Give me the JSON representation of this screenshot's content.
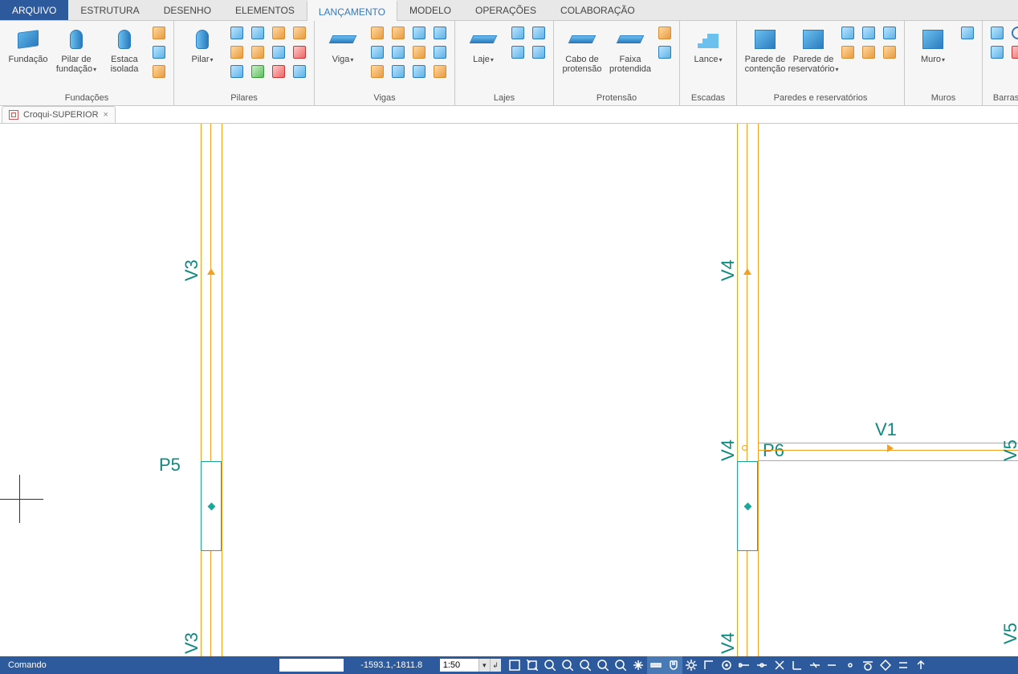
{
  "tabs": {
    "file": "ARQUIVO",
    "items": [
      "ESTRUTURA",
      "DESENHO",
      "ELEMENTOS",
      "LANÇAMENTO",
      "MODELO",
      "OPERAÇÕES",
      "COLABORAÇÃO"
    ],
    "active_index": 3
  },
  "ribbon": {
    "groups": [
      {
        "title": "Fundações",
        "big": [
          {
            "name": "fundacao",
            "label": "Fundação"
          },
          {
            "name": "pilar-fundacao",
            "label": "Pilar de\nfundação",
            "drop": true
          },
          {
            "name": "estaca",
            "label": "Estaca\nisolada"
          }
        ],
        "small_cols": [
          [
            "mini o",
            "mini b",
            "mini o"
          ]
        ]
      },
      {
        "title": "Pilares",
        "big": [
          {
            "name": "pilar",
            "label": "Pilar",
            "drop": true
          }
        ],
        "small_cols": [
          [
            "mini b",
            "mini o",
            "mini b"
          ],
          [
            "mini b",
            "mini o",
            "mini g"
          ],
          [
            "mini o",
            "mini b",
            "mini r"
          ],
          [
            "mini o",
            "mini r",
            "mini b"
          ]
        ]
      },
      {
        "title": "Vigas",
        "big": [
          {
            "name": "viga",
            "label": "Viga",
            "drop": true
          }
        ],
        "small_cols": [
          [
            "mini o",
            "mini b",
            "mini o"
          ],
          [
            "mini o",
            "mini b",
            "mini b"
          ],
          [
            "mini b",
            "mini o",
            "mini b"
          ],
          [
            "mini b",
            "mini b",
            "mini o"
          ]
        ]
      },
      {
        "title": "Lajes",
        "big": [
          {
            "name": "laje",
            "label": "Laje",
            "drop": true
          }
        ],
        "small_cols": [
          [
            "mini b",
            "mini b"
          ],
          [
            "mini b",
            "mini b"
          ]
        ]
      },
      {
        "title": "Protensão",
        "big": [
          {
            "name": "cabo",
            "label": "Cabo de\nprotensão"
          },
          {
            "name": "faixa",
            "label": "Faixa\nprotendida"
          }
        ],
        "small_cols": [
          [
            "mini o",
            "mini b"
          ]
        ]
      },
      {
        "title": "Escadas",
        "big": [
          {
            "name": "lance",
            "label": "Lance",
            "drop": true
          }
        ]
      },
      {
        "title": "Paredes e reservatórios",
        "big": [
          {
            "name": "parede-cont",
            "label": "Parede de\ncontenção"
          },
          {
            "name": "parede-resv",
            "label": "Parede de\nreservatório",
            "drop": true
          }
        ],
        "small_cols": [
          [
            "mini b",
            "mini o"
          ],
          [
            "mini b",
            "mini o"
          ],
          [
            "mini b",
            "mini o"
          ]
        ]
      },
      {
        "title": "Muros",
        "big": [
          {
            "name": "muro",
            "label": "Muro",
            "drop": true
          }
        ],
        "small_cols": [
          [
            "mini b"
          ]
        ]
      },
      {
        "title": "Barras e nós",
        "big": [],
        "small_cols": [
          [
            "mini b",
            "mini b"
          ],
          [
            "circle",
            "mini r"
          ],
          [
            "rect",
            "mini r"
          ]
        ]
      }
    ]
  },
  "document_tab": {
    "label": "Croqui-SUPERIOR"
  },
  "drawing": {
    "labels": {
      "P5": "P5",
      "P6": "P6",
      "V1": "V1",
      "V3t": "V3",
      "V3b": "V3",
      "V4t": "V4",
      "V4m": "V4",
      "V4b": "V4",
      "V5t": "V5",
      "V5b": "V5"
    }
  },
  "status": {
    "prompt": "Comando",
    "command_value": "",
    "coords": "-1593.1,-1811.8",
    "scale": "1:50",
    "icons": [
      {
        "name": "zoom-extents-icon",
        "active": false
      },
      {
        "name": "zoom-window-icon",
        "active": false
      },
      {
        "name": "zoom-in-icon",
        "active": false
      },
      {
        "name": "zoom-prev-icon",
        "active": false
      },
      {
        "name": "zoom-realtime-icon",
        "active": false
      },
      {
        "name": "zoom-obj-icon",
        "active": false
      },
      {
        "name": "zoom-center-icon",
        "active": false
      },
      {
        "name": "pan-icon",
        "active": false
      },
      {
        "name": "ruler-icon",
        "active": true
      },
      {
        "name": "snap-magnet-icon",
        "active": true
      },
      {
        "name": "settings-gear-icon",
        "active": false
      },
      {
        "name": "ortho-icon",
        "active": false
      },
      {
        "name": "target-icon",
        "active": false
      },
      {
        "name": "snap-end-icon",
        "active": false
      },
      {
        "name": "snap-mid-icon",
        "active": false
      },
      {
        "name": "snap-int-icon",
        "active": false
      },
      {
        "name": "snap-perp-icon",
        "active": false
      },
      {
        "name": "snap-near-icon",
        "active": false
      },
      {
        "name": "snap-ext-icon",
        "active": false
      },
      {
        "name": "snap-node-icon",
        "active": false
      },
      {
        "name": "snap-tan-icon",
        "active": false
      },
      {
        "name": "snap-quad-icon",
        "active": false
      },
      {
        "name": "snap-par-icon",
        "active": false
      },
      {
        "name": "snap-ins-icon",
        "active": false
      }
    ]
  }
}
